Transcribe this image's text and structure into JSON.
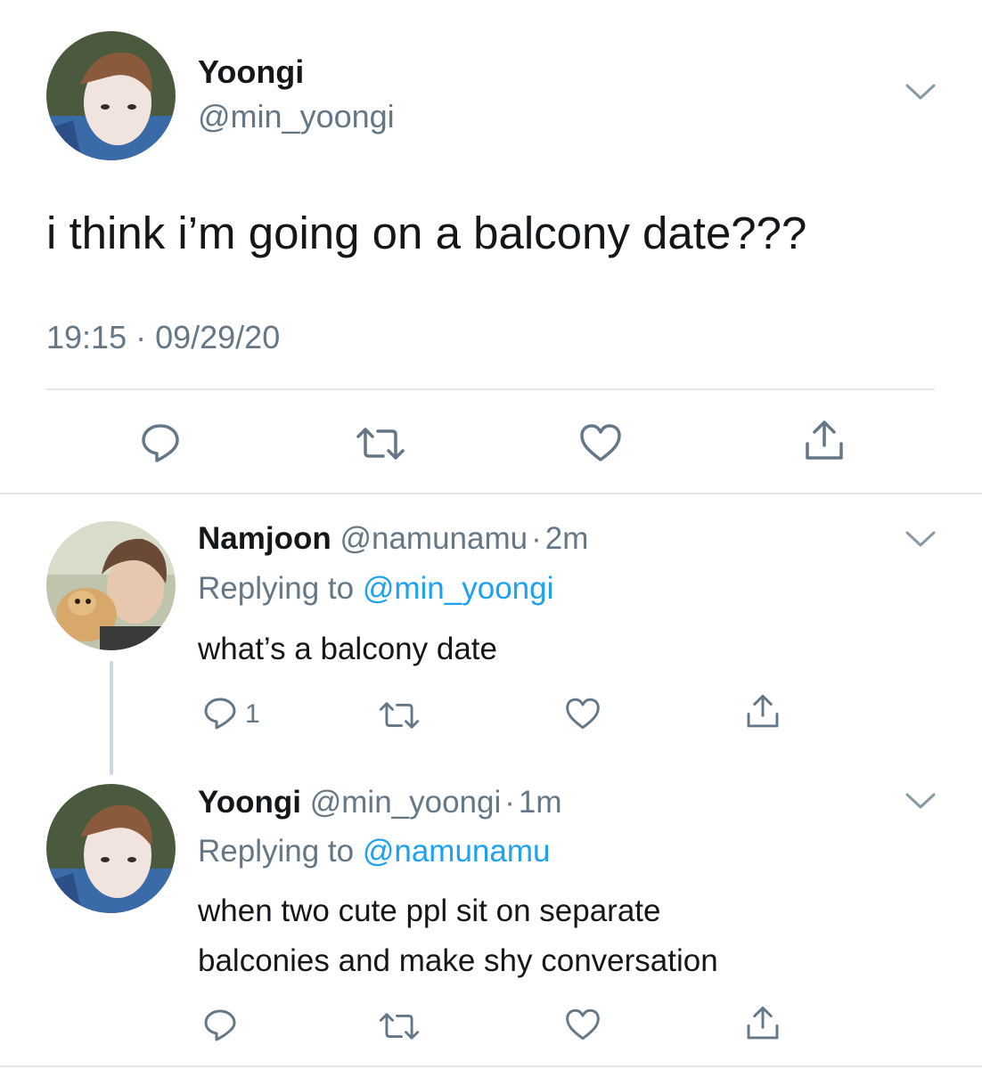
{
  "main_tweet": {
    "display_name": "Yoongi",
    "handle": "@min_yoongi",
    "text": "i think i’m going on a balcony date???",
    "timestamp": "19:15 · 09/29/20",
    "actions": [
      "reply",
      "retweet",
      "like",
      "share"
    ]
  },
  "replies": [
    {
      "display_name": "Namjoon",
      "handle": "@namunamu",
      "sep": "·",
      "age": "2m",
      "replying_prefix": "Replying to",
      "replying_to": "@min_yoongi",
      "text": "what’s a balcony date",
      "reply_count": "1"
    },
    {
      "display_name": "Yoongi",
      "handle": "@min_yoongi",
      "sep": "·",
      "age": "1m",
      "replying_prefix": "Replying to",
      "replying_to": "@namunamu",
      "text_line1": "when two cute ppl sit on separate",
      "text_line2": "balconies and make shy conversation"
    }
  ],
  "colors": {
    "text": "#14171a",
    "muted": "#657786",
    "link": "#1da1f2",
    "divider": "#e1e8ed",
    "icon": "#657786"
  },
  "icons": [
    "chevron-down-icon",
    "reply-icon",
    "retweet-icon",
    "heart-icon",
    "share-icon"
  ]
}
